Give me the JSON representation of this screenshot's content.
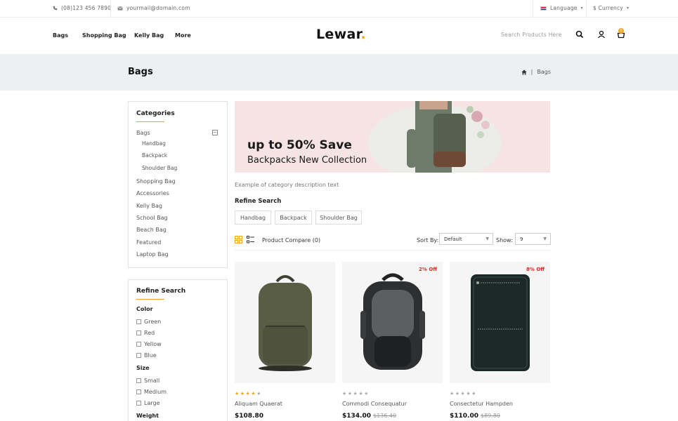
{
  "topbar": {
    "phone": "(08)123 456 7890",
    "email": "yourmail@domain.com",
    "language": "Language",
    "currency": "$ Currency"
  },
  "nav": {
    "items": [
      "Bags",
      "Shopping Bag",
      "Kelly Bag",
      "More"
    ]
  },
  "logo": {
    "text": "Lewar",
    "accent": "."
  },
  "search": {
    "placeholder": "Search Products Here"
  },
  "cart": {
    "count": "0"
  },
  "page": {
    "title": "Bags",
    "breadcrumb_sep": "|",
    "breadcrumb_current": "Bags"
  },
  "categories": {
    "title": "Categories",
    "parent": "Bags",
    "toggle": "−",
    "children": [
      "Handbag",
      "Backpack",
      "Shoulder Bag"
    ],
    "items": [
      "Shopping Bag",
      "Accessories",
      "Kelly Bag",
      "School Bag",
      "Beach Bag",
      "Featured",
      "Laptop Bag"
    ]
  },
  "filters": {
    "title": "Refine Search",
    "color_label": "Color",
    "colors": [
      "Green",
      "Red",
      "Yellow",
      "Blue"
    ],
    "size_label": "Size",
    "sizes": [
      "Small",
      "Medium",
      "Large"
    ],
    "weight_label": "Weight"
  },
  "banner": {
    "line1": "up to 50% Save",
    "line2": "Backpacks New Collection"
  },
  "description": "Example of category description text",
  "refine": {
    "title": "Refine Search",
    "tags": [
      "Handbag",
      "Backpack",
      "Shoulder Bag"
    ]
  },
  "toolbar": {
    "compare": "Product Compare (0)",
    "sort_label": "Sort By:",
    "sort_value": "Default",
    "show_label": "Show:",
    "show_value": "9"
  },
  "products": [
    {
      "name": "Aliquam Quaerat",
      "price": "$108.80",
      "old_price": "",
      "discount": "",
      "rating": 4
    },
    {
      "name": "Commodi Consequatur",
      "price": "$134.00",
      "old_price": "$136.40",
      "discount": "2% Off",
      "rating": 0
    },
    {
      "name": "Consectetur Hampden",
      "price": "$110.00",
      "old_price": "$89.80",
      "discount": "8% Off",
      "rating": 0
    }
  ],
  "colors": {
    "accent": "#f4a51c",
    "discount": "#e0261c",
    "band": "#edf0f3"
  },
  "icons": [
    "phone-icon",
    "mail-icon",
    "flag-icon",
    "search-icon",
    "user-icon",
    "cart-icon",
    "home-icon",
    "grid-view-icon",
    "list-view-icon"
  ]
}
